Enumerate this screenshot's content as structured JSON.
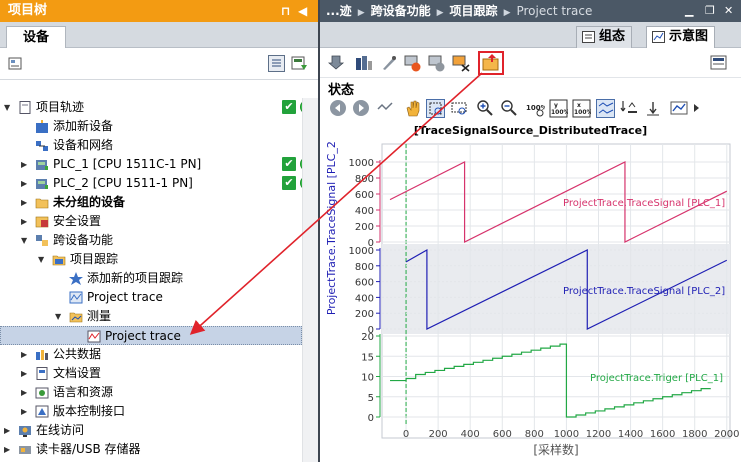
{
  "left": {
    "title": "项目树",
    "tab": "设备",
    "tree": [
      {
        "label": "项目轨迹",
        "level": 0,
        "arrow": "▼",
        "icon": "project-icon",
        "status": true,
        "bold": false
      },
      {
        "label": "添加新设备",
        "level": 1,
        "arrow": "",
        "icon": "add-device-icon",
        "status": false,
        "bold": false
      },
      {
        "label": "设备和网络",
        "level": 1,
        "arrow": "",
        "icon": "network-icon",
        "status": false,
        "bold": false
      },
      {
        "label": "PLC_1 [CPU 1511C-1 PN]",
        "level": 1,
        "arrow": "▶",
        "icon": "plc-icon",
        "status": true,
        "bold": false
      },
      {
        "label": "PLC_2 [CPU 1511-1 PN]",
        "level": 1,
        "arrow": "▶",
        "icon": "plc-icon",
        "status": true,
        "bold": false
      },
      {
        "label": "未分组的设备",
        "level": 1,
        "arrow": "▶",
        "icon": "folder-icon",
        "status": false,
        "bold": true
      },
      {
        "label": "安全设置",
        "level": 1,
        "arrow": "▶",
        "icon": "security-icon",
        "status": false,
        "bold": false
      },
      {
        "label": "跨设备功能",
        "level": 1,
        "arrow": "▼",
        "icon": "cross-device-icon",
        "status": false,
        "bold": false
      },
      {
        "label": "项目跟踪",
        "level": 2,
        "arrow": "▼",
        "icon": "trace-folder-icon",
        "status": false,
        "bold": false
      },
      {
        "label": "添加新的项目跟踪",
        "level": 3,
        "arrow": "",
        "icon": "add-trace-icon",
        "status": false,
        "bold": false
      },
      {
        "label": "Project trace",
        "level": 3,
        "arrow": "",
        "icon": "trace-icon",
        "status": false,
        "bold": false
      },
      {
        "label": "测量",
        "level": 3,
        "arrow": "▼",
        "icon": "measurement-folder-icon",
        "status": false,
        "bold": false
      },
      {
        "label": "Project trace",
        "level": 4,
        "arrow": "",
        "icon": "measurement-icon",
        "status": false,
        "bold": false,
        "selected": true
      },
      {
        "label": "公共数据",
        "level": 1,
        "arrow": "▶",
        "icon": "common-data-icon",
        "status": false,
        "bold": false
      },
      {
        "label": "文档设置",
        "level": 1,
        "arrow": "▶",
        "icon": "document-icon",
        "status": false,
        "bold": false
      },
      {
        "label": "语言和资源",
        "level": 1,
        "arrow": "▶",
        "icon": "language-icon",
        "status": false,
        "bold": false
      },
      {
        "label": "版本控制接口",
        "level": 1,
        "arrow": "▶",
        "icon": "version-icon",
        "status": false,
        "bold": false
      },
      {
        "label": "在线访问",
        "level": 0,
        "arrow": "▶",
        "icon": "online-icon",
        "status": false,
        "bold": false
      },
      {
        "label": "读卡器/USB 存储器",
        "level": 0,
        "arrow": "▶",
        "icon": "usb-icon",
        "status": false,
        "bold": false
      }
    ]
  },
  "right": {
    "breadcrumb": [
      "...迹",
      "跨设备功能",
      "项目跟踪",
      "Project trace"
    ],
    "tabs": {
      "config": "组态",
      "diagram": "示意图"
    },
    "status_label": "状态",
    "chart_title": "[TraceSignalSource_DistributedTrace]"
  },
  "colors": {
    "orange": "#f39b12",
    "signal1": "#d6336c",
    "signal2": "#1f1fb4",
    "trigger": "#22a845",
    "highlight": "#e0232b"
  },
  "chart_data": {
    "type": "line",
    "xlabel": "[采样数]",
    "ylabel": "ProjectTrace.TraceSignal [PLC_2]",
    "x_ticks": [
      0,
      200,
      400,
      600,
      800,
      1000,
      1200,
      1400,
      1600,
      1800,
      2000
    ],
    "xlim": [
      -150,
      2020
    ],
    "trigger_x": 0,
    "series": [
      {
        "name": "ProjectTrace.TraceSignal [PLC_1]",
        "color": "#d6336c",
        "yticks": [
          0,
          200,
          400,
          600,
          800,
          1000
        ],
        "ylim": [
          0,
          1000
        ],
        "points": [
          [
            -100,
            530
          ],
          [
            365,
            1000
          ],
          [
            365,
            0
          ],
          [
            1365,
            1000
          ],
          [
            1365,
            0
          ],
          [
            2000,
            635
          ]
        ]
      },
      {
        "name": "ProjectTrace.TraceSignal [PLC_2]",
        "color": "#1f1fb4",
        "yticks": [
          0,
          200,
          400,
          600,
          800,
          1000
        ],
        "ylim": [
          0,
          1000
        ],
        "points": [
          [
            0,
            850
          ],
          [
            130,
            1000
          ],
          [
            130,
            0
          ],
          [
            1130,
            1000
          ],
          [
            1130,
            0
          ],
          [
            2000,
            870
          ]
        ]
      },
      {
        "name": "ProjectTrace.Triger [PLC_1]",
        "color": "#22a845",
        "yticks": [
          0,
          5,
          10,
          15,
          20
        ],
        "ylim": [
          0,
          20
        ],
        "step": true,
        "points": [
          [
            -100,
            9
          ],
          [
            0,
            9.5
          ],
          [
            60,
            10.5
          ],
          [
            120,
            11
          ],
          [
            180,
            11.5
          ],
          [
            240,
            12
          ],
          [
            300,
            12.5
          ],
          [
            360,
            13
          ],
          [
            420,
            13.5
          ],
          [
            480,
            14
          ],
          [
            540,
            14.5
          ],
          [
            600,
            15
          ],
          [
            660,
            15.5
          ],
          [
            720,
            16
          ],
          [
            780,
            16.5
          ],
          [
            840,
            17
          ],
          [
            900,
            17.5
          ],
          [
            960,
            18
          ],
          [
            1000,
            18
          ],
          [
            1000,
            0
          ],
          [
            1060,
            0.5
          ],
          [
            1120,
            1
          ],
          [
            1180,
            1.5
          ],
          [
            1240,
            2
          ],
          [
            1300,
            2.5
          ],
          [
            1360,
            3
          ],
          [
            1420,
            3.5
          ],
          [
            1480,
            4
          ],
          [
            1540,
            4.5
          ],
          [
            1600,
            5
          ],
          [
            1660,
            5.5
          ],
          [
            1720,
            6
          ],
          [
            1780,
            6.5
          ],
          [
            1840,
            7
          ],
          [
            1900,
            7
          ],
          [
            1900,
            7
          ]
        ]
      }
    ]
  }
}
